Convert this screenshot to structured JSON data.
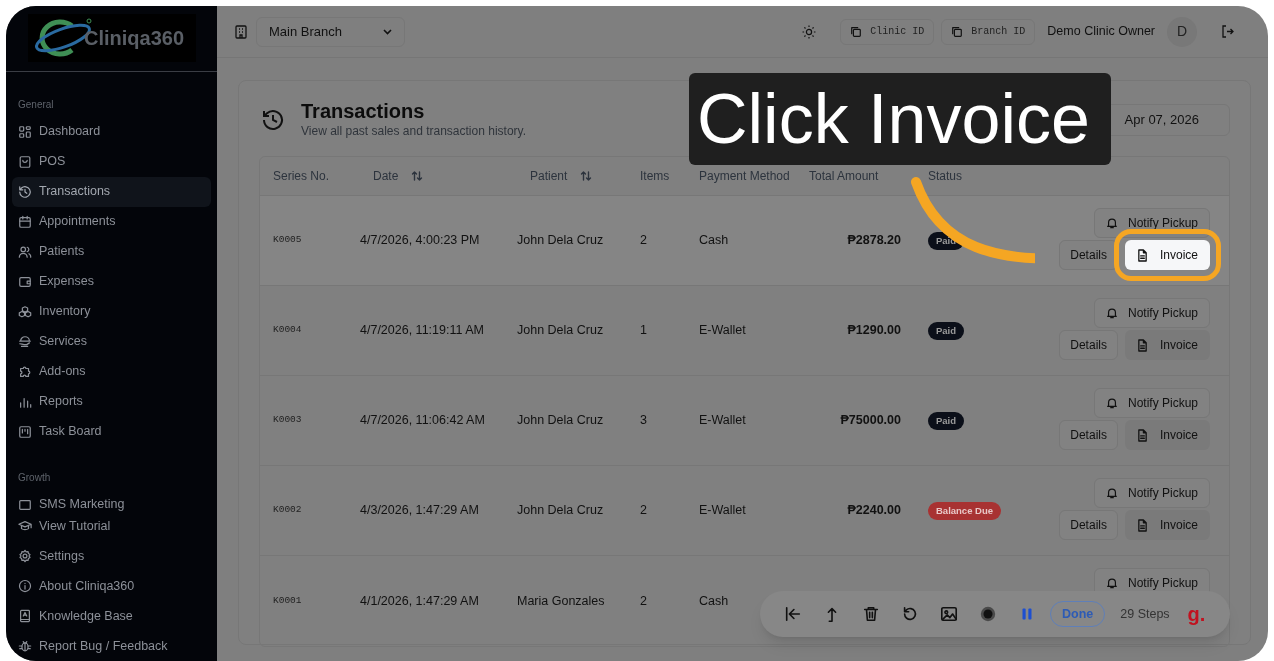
{
  "logo": {
    "text": "Cliniqa360"
  },
  "sidebar": {
    "sections": [
      {
        "title": "General",
        "items": [
          {
            "label": "Dashboard",
            "selected": false
          },
          {
            "label": "POS",
            "selected": false
          },
          {
            "label": "Transactions",
            "selected": true
          },
          {
            "label": "Appointments",
            "selected": false
          },
          {
            "label": "Patients",
            "selected": false
          },
          {
            "label": "Expenses",
            "selected": false
          },
          {
            "label": "Inventory",
            "selected": false
          },
          {
            "label": "Services",
            "selected": false
          },
          {
            "label": "Add-ons",
            "selected": false
          },
          {
            "label": "Reports",
            "selected": false
          },
          {
            "label": "Task Board",
            "selected": false
          }
        ]
      },
      {
        "title": "Growth",
        "items": [
          {
            "label": "SMS Marketing",
            "selected": false
          }
        ]
      }
    ],
    "footer_items": [
      {
        "label": "View Tutorial"
      },
      {
        "label": "Settings"
      },
      {
        "label": "About Cliniqa360"
      },
      {
        "label": "Knowledge Base"
      },
      {
        "label": "Report Bug / Feedback"
      }
    ]
  },
  "header": {
    "branch_select": "Main Branch",
    "clinic_id": "Clinic ID",
    "branch_id": "Branch ID",
    "user": "Demo Clinic Owner",
    "avatar": "D"
  },
  "page": {
    "title": "Transactions",
    "subtitle": "View all past sales and transaction history.",
    "date_range": "Apr 07, 2026"
  },
  "table": {
    "columns": [
      {
        "label": "Series No."
      },
      {
        "label": "Date"
      },
      {
        "label": "Patient"
      },
      {
        "label": "Items"
      },
      {
        "label": "Payment Method"
      },
      {
        "label": "Total Amount"
      },
      {
        "label": "Status"
      }
    ],
    "rows": [
      {
        "series": "K0005",
        "date": "4/7/2026, 4:00:23 PM",
        "patient": "John Dela Cruz",
        "items": "2",
        "payment": "Cash",
        "total": "₱2878.20",
        "status": {
          "label": "Paid",
          "kind": "paid"
        },
        "actions": {
          "notify": "Notify Pickup",
          "details": "Details",
          "invoice": "Invoice"
        },
        "highlighted": true
      },
      {
        "series": "K0004",
        "date": "4/7/2026, 11:19:11 AM",
        "patient": "John Dela Cruz",
        "items": "1",
        "payment": "E-Wallet",
        "total": "₱1290.00",
        "status": {
          "label": "Paid",
          "kind": "paid"
        },
        "actions": {
          "notify": "Notify Pickup",
          "details": "Details",
          "invoice": "Invoice"
        },
        "highlighted": false
      },
      {
        "series": "K0003",
        "date": "4/7/2026, 11:06:42 AM",
        "patient": "John Dela Cruz",
        "items": "3",
        "payment": "E-Wallet",
        "total": "₱75000.00",
        "status": {
          "label": "Paid",
          "kind": "paid"
        },
        "actions": {
          "notify": "Notify Pickup",
          "details": "Details",
          "invoice": "Invoice"
        },
        "highlighted": false
      },
      {
        "series": "K0002",
        "date": "4/3/2026, 1:47:29 AM",
        "patient": "John Dela Cruz",
        "items": "2",
        "payment": "E-Wallet",
        "total": "₱2240.00",
        "status": {
          "label": "Balance Due",
          "kind": "due"
        },
        "actions": {
          "notify": "Notify Pickup",
          "details": "Details",
          "invoice": "Invoice"
        },
        "highlighted": false
      },
      {
        "series": "K0001",
        "date": "4/1/2026, 1:47:29 AM",
        "patient": "Maria Gonzales",
        "items": "2",
        "payment": "Cash",
        "actions": {
          "notify": "Notify Pickup"
        },
        "highlighted": false
      }
    ]
  },
  "tutorial": {
    "callout": "Click Invoice"
  },
  "recorder": {
    "paused": false,
    "done": "Done",
    "steps": "29 Steps",
    "logo": "g."
  }
}
